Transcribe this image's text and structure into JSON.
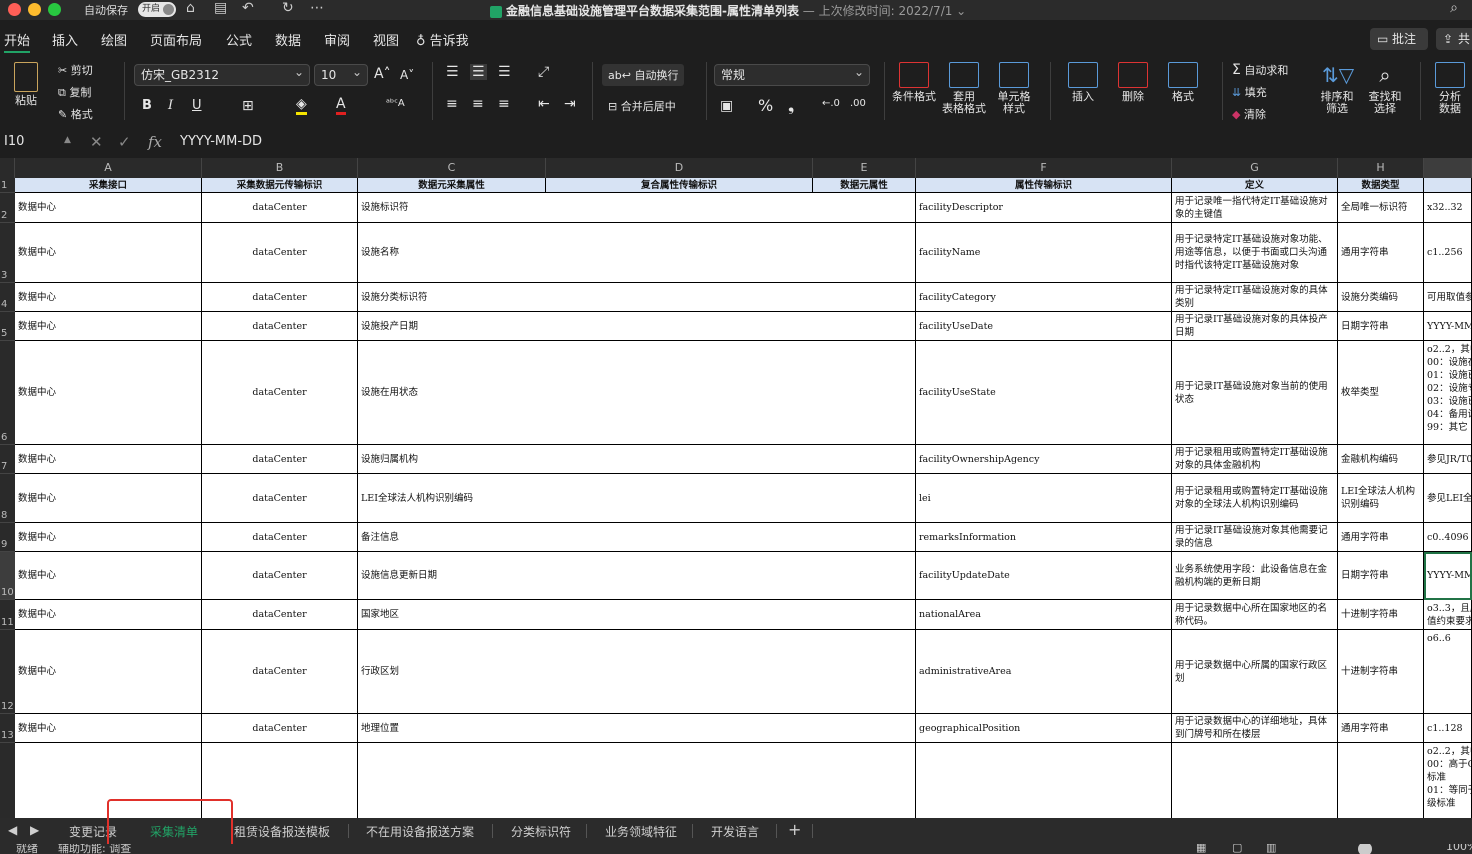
{
  "titlebar": {
    "autosave_label": "自动保存",
    "autosave_state": "开启",
    "doc_title": "金融信息基础设施管理平台数据采集范围-属性清单列表",
    "last_modified": " — 上次修改时间: 2022/7/1 ⌄"
  },
  "tabs": [
    "开始",
    "插入",
    "绘图",
    "页面布局",
    "公式",
    "数据",
    "审阅",
    "视图",
    "告诉我"
  ],
  "actions": {
    "comment": "批注",
    "share": "共"
  },
  "ribbon": {
    "paste": "粘贴",
    "cut": "剪切",
    "copy": "复制",
    "format_painter": "格式",
    "font": "仿宋_GB2312",
    "font_size": "10",
    "bold": "B",
    "italic": "I",
    "underline": "U",
    "wrap_text": "自动换行",
    "merge_center": "合并后居中",
    "number_format": "常规",
    "percent": "%",
    "comma": "❟",
    "conditional_format": "条件格式",
    "table_format_1": "套用",
    "table_format_2": "表格格式",
    "cell_style_1": "单元格",
    "cell_style_2": "样式",
    "insert": "插入",
    "delete": "删除",
    "format": "格式",
    "autosum": "自动求和",
    "fill": "填充",
    "clear": "清除",
    "sort_filter_1": "排序和",
    "sort_filter_2": "筛选",
    "find_select_1": "查找和",
    "find_select_2": "选择",
    "analyze_1": "分析",
    "analyze_2": "数据"
  },
  "formula_bar": {
    "cell_ref": "I10",
    "value": "YYYY-MM-DD",
    "fx": "fx"
  },
  "columns": [
    "A",
    "B",
    "C",
    "D",
    "E",
    "F",
    "G",
    "H"
  ],
  "header_row": [
    "采集接口",
    "采集数据元传输标识",
    "数据元采集属性",
    "复合属性传输标识",
    "数据元属性",
    "属性传输标识",
    "定义",
    "数据类型"
  ],
  "rows": [
    {
      "num": "2",
      "a": "数据中心",
      "b": "dataCenter",
      "c": "设施标识符",
      "f": "facilityDescriptor",
      "g": "用于记录唯一指代特定IT基础设施对象的主键值",
      "h": "全局唯一标识符",
      "i": "x32..32"
    },
    {
      "num": "3",
      "a": "数据中心",
      "b": "dataCenter",
      "c": "设施名称",
      "f": "facilityName",
      "g": "用于记录特定IT基础设施对象功能、用途等信息，以便于书面或口头沟通时指代该特定IT基础设施对象",
      "h": "通用字符串",
      "i": "c1..256"
    },
    {
      "num": "4",
      "a": "数据中心",
      "b": "dataCenter",
      "c": "设施分类标识符",
      "f": "facilityCategory",
      "g": "用于记录特定IT基础设施对象的具体类别",
      "h": "设施分类编码",
      "i": "可用取值参"
    },
    {
      "num": "5",
      "a": "数据中心",
      "b": "dataCenter",
      "c": "设施投产日期",
      "f": "facilityUseDate",
      "g": "用于记录IT基础设施对象的具体投产日期",
      "h": "日期字符串",
      "i": "YYYY-MM"
    },
    {
      "num": "6",
      "a": "数据中心",
      "b": "dataCenter",
      "c": "设施在用状态",
      "f": "facilityUseState",
      "g": "用于记录IT基础设施对象当前的使用状态",
      "h": "枚举类型",
      "i": "o2..2，其中\n00：设施在\n01：设施已\n02：设施专\n03：设施已\n04：备用设\n99：其它"
    },
    {
      "num": "7",
      "a": "数据中心",
      "b": "dataCenter",
      "c": "设施归属机构",
      "f": "facilityOwnershipAgency",
      "g": "用于记录租用或购置特定IT基础设施对象的具体金融机构",
      "h": "金融机构编码",
      "i": "参见JR/T0"
    },
    {
      "num": "8",
      "a": "数据中心",
      "b": "dataCenter",
      "c": "LEI全球法人机构识别编码",
      "f": "lei",
      "g": "用于记录租用或购置特定IT基础设施对象的全球法人机构识别编码",
      "h": "LEI全球法人机构识别编码",
      "i": "参见LEI全"
    },
    {
      "num": "9",
      "a": "数据中心",
      "b": "dataCenter",
      "c": "备注信息",
      "f": "remarksInformation",
      "g": "用于记录IT基础设施对象其他需要记录的信息",
      "h": "通用字符串",
      "i": "c0..4096"
    },
    {
      "num": "10",
      "a": "数据中心",
      "b": "dataCenter",
      "c": "设施信息更新日期",
      "f": "facilityUpdateDate",
      "g": "业务系统使用字段：此设备信息在金融机构端的更新日期",
      "h": "日期字符串",
      "i": "YYYY-MM"
    },
    {
      "num": "11",
      "a": "数据中心",
      "b": "dataCenter",
      "c": "国家地区",
      "f": "nationalArea",
      "g": "用于记录数据中心所在国家地区的名称代码。",
      "h": "十进制字符串",
      "i": "o3..3，且应\n值约束要求"
    },
    {
      "num": "12",
      "a": "数据中心",
      "b": "dataCenter",
      "c": "行政区划",
      "f": "administrativeArea",
      "g": "用于记录数据中心所属的国家行政区划",
      "h": "十进制字符串",
      "i": "o6..6"
    },
    {
      "num": "13",
      "a": "数据中心",
      "b": "dataCenter",
      "c": "地理位置",
      "f": "geographicalPosition",
      "g": "用于记录数据中心的详细地址，具体到门牌号和所在楼层",
      "h": "通用字符串",
      "i": "c1..128"
    },
    {
      "num": "",
      "a": "",
      "b": "",
      "c": "",
      "f": "",
      "g": "",
      "h": "",
      "i": "o2..2，其中\n00：高于C\n标准\n01：等同于\n级标准"
    }
  ],
  "sheet_tabs": [
    "变更记录",
    "采集清单",
    "租赁设备报送模板",
    "不在用设备报送方案",
    "分类标识符",
    "业务领域特征",
    "开发语言",
    "+"
  ],
  "status": {
    "ready": "就绪",
    "accessibility": "辅助功能: 调查",
    "zoom": "100%"
  }
}
